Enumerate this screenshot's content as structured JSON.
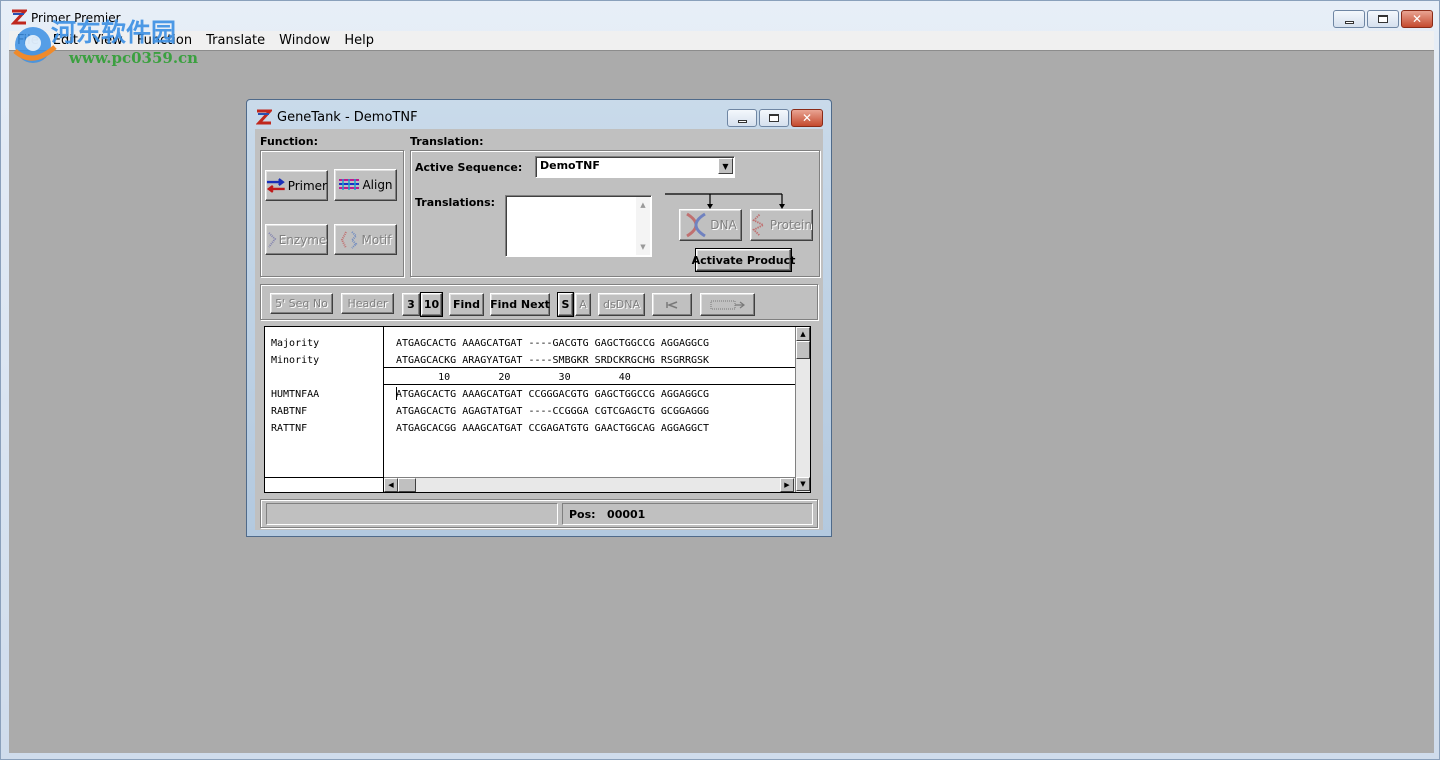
{
  "app": {
    "title": "Primer Premier",
    "menu": [
      "File",
      "Edit",
      "View",
      "Function",
      "Translate",
      "Window",
      "Help"
    ]
  },
  "watermark": {
    "cn_text": "河东软件园",
    "url": "www.pc0359.cn"
  },
  "genetank": {
    "title": "GeneTank - DemoTNF",
    "function_label": "Function:",
    "translation_label": "Translation:",
    "buttons": {
      "primer": "Primer",
      "align": "Align",
      "enzyme": "Enzyme",
      "motif": "Motif",
      "dna": "DNA",
      "protein": "Protein",
      "activate_product": "Activate Product"
    },
    "active_sequence_label": "Active Sequence:",
    "active_sequence_value": "DemoTNF",
    "translations_label": "Translations:",
    "toolbar": {
      "seq_no": "5' Seq No",
      "header": "Header",
      "three": "3",
      "ten": "10",
      "find": "Find",
      "find_next": "Find Next",
      "s": "S",
      "a": "A",
      "dsdna": "dsDNA"
    },
    "sequences": {
      "consensus": [
        {
          "name": "Majority",
          "seq": "ATGAGCACTG AAAGCATGAT ----GACGTG GAGCTGGCCG AGGAGGCG"
        },
        {
          "name": "Minority",
          "seq": "ATGAGCACKG ARAGYATGAT ----SMBGKR SRDCKRGCHG RSGRRGSK"
        }
      ],
      "ruler": "       10        20        30        40",
      "rows": [
        {
          "name": "HUMTNFAA",
          "seq": "ATGAGCACTG AAAGCATGAT CCGGGACGTG GAGCTGGCCG AGGAGGCG"
        },
        {
          "name": "RABTNF",
          "seq": "ATGAGCACTG AGAGTATGAT ----CCGGGA CGTCGAGCTG GCGGAGGG"
        },
        {
          "name": "RATTNF",
          "seq": "ATGAGCACGG AAAGCATGAT CCGAGATGTG GAACTGGCAG AGGAGGCT"
        }
      ]
    },
    "status": {
      "left": "",
      "pos": "Pos:   00001"
    }
  }
}
